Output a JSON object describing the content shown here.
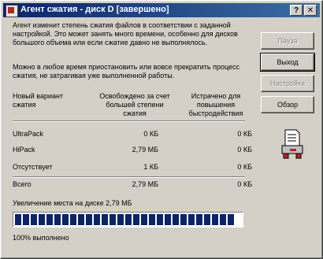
{
  "window": {
    "title": "Агент сжатия - диск D [завершено]",
    "help_label": "?",
    "close_label": "✕"
  },
  "intro_text": "Агент изменит степень сжатия файлов в соответствии с заданной настройкой. Это может занять много времени, особенно для дисков большого объема или если сжатие давно не выполнялось.",
  "pause_text": "Можно в любое время приостановить или вовсе прекратить процесс сжатия, не затрагивая уже выполненной работы.",
  "buttons": {
    "pause": "Пауза",
    "exit": "Выход",
    "settings": "Настройка",
    "overview": "Обзор"
  },
  "table": {
    "headers": [
      "Новый вариант сжатия",
      "Освобождено за счет большей степени сжатия",
      "Истрачено для повышения быстродействия"
    ],
    "rows": [
      {
        "name": "UltraPack",
        "freed": "0 КБ",
        "spent": "0 КБ"
      },
      {
        "name": "HiPack",
        "freed": "2,79 МБ",
        "spent": "0 КБ"
      },
      {
        "name": "Отсутствует",
        "freed": "1 КБ",
        "spent": "0 КБ"
      },
      {
        "name": "Всего",
        "freed": "2,79 МБ",
        "spent": "0 КБ"
      }
    ]
  },
  "gain_text": "Увеличение места на диске 2,79 МБ",
  "progress": {
    "percent": 100
  },
  "status_text": "100% выполнено",
  "icons": {
    "title": "app-icon",
    "status": "printer-icon"
  }
}
